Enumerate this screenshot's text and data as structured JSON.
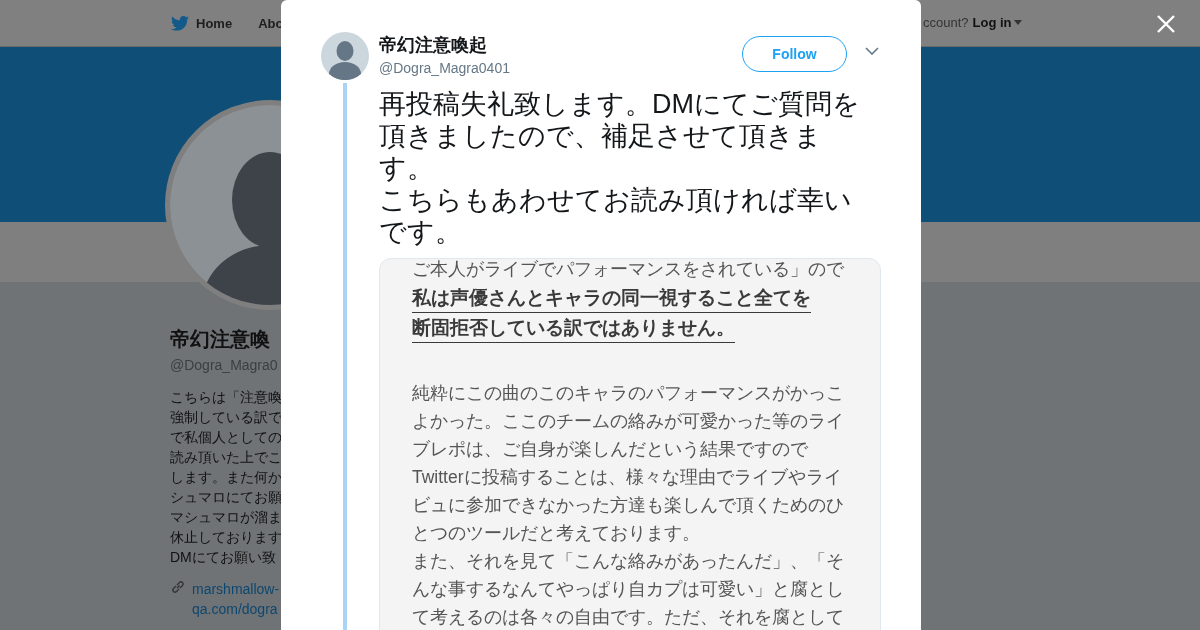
{
  "nav": {
    "items": [
      {
        "label": "Home",
        "kind": "home"
      },
      {
        "label": "Abo",
        "kind": "plain"
      }
    ],
    "account_prompt": "ccount?",
    "login": "Log in"
  },
  "profile": {
    "name": "帝幻注意喚",
    "handle": "@Dogra_Magra0",
    "bio_lines": [
      "こちらは「注意喚",
      "強制している訳で",
      "で私個人としての",
      "読み頂いた上でこ",
      "します。また何か",
      "シュマロにてお願",
      "マシュマロが溜ま",
      "休止しております",
      "DMにてお願い致"
    ],
    "link_lines": [
      "marshmallow-",
      "qa.com/dogra"
    ]
  },
  "tweet": {
    "name": "帝幻注意喚起",
    "handle": "@Dogra_Magra0401",
    "follow": "Follow",
    "text_paragraphs": [
      "再投稿失礼致します。DMにてご質問を頂きましたので、補足させて頂きます。",
      "こちらもあわせてお読み頂ければ幸いです。"
    ],
    "image_lines": [
      {
        "text": "ご本人がライブでパフォーマンスをされている」ので",
        "bold": false
      },
      {
        "text": "私は声優さんとキャラの同一視すること全てを",
        "bold": true
      },
      {
        "text": "断固拒否している訳ではありません。",
        "bold": true
      },
      {
        "text": "純粋にこの曲のこのキャラのパフォーマンスがかっこ",
        "bold": false,
        "gap": true
      },
      {
        "text": "よかった。ここのチームの絡みが可愛かった等のライ",
        "bold": false
      },
      {
        "text": "ブレポは、ご自身が楽しんだという結果ですので",
        "bold": false
      },
      {
        "text": "Twitterに投稿することは、様々な理由でライブやライ",
        "bold": false
      },
      {
        "text": "ビュに参加できなかった方達も楽しんで頂くためのひ",
        "bold": false
      },
      {
        "text": "とつのツールだと考えております。",
        "bold": false
      },
      {
        "text": "また、それを見て「こんな絡みがあったんだ」、「そ",
        "bold": false
      },
      {
        "text": "んな事するなんてやっぱり自カプは可愛い」と腐とし",
        "bold": false
      },
      {
        "text": "て考えるのは各々の自由です。ただ、それを腐として",
        "bold": false
      }
    ]
  }
}
